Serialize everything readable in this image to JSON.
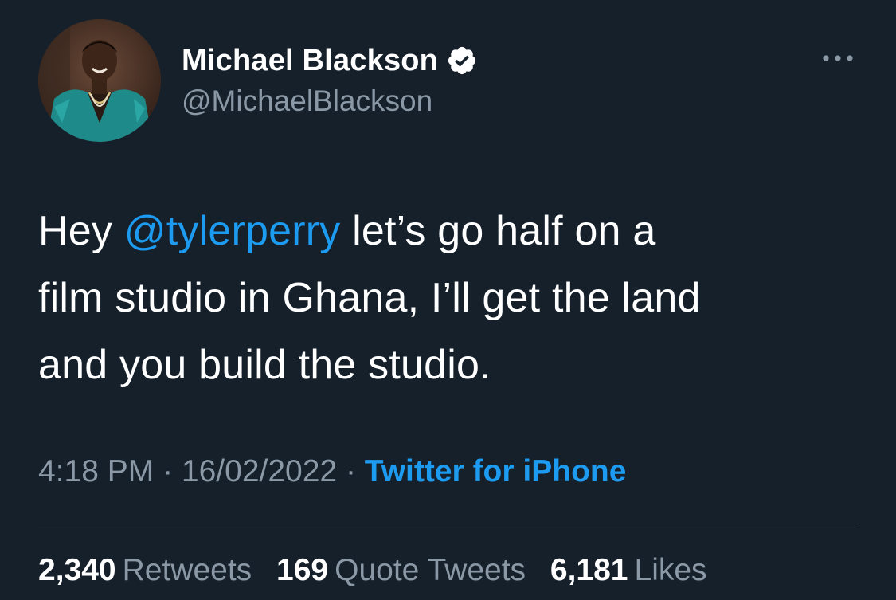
{
  "user": {
    "display_name": "Michael Blackson",
    "handle": "@MichaelBlackson",
    "verified": true
  },
  "tweet": {
    "text_before": "Hey ",
    "mention": "@tylerperry",
    "line1_after": " let’s go half on a",
    "line2": "film studio in Ghana, I’ll get the land",
    "line3": "and you build the studio."
  },
  "meta": {
    "time": "4:18 PM",
    "separator1": " · ",
    "date": "16/02/2022",
    "separator2": " · ",
    "source": "Twitter for iPhone"
  },
  "stats": {
    "retweets_count": "2,340",
    "retweets_label": "Retweets",
    "quotes_count": "169",
    "quotes_label": "Quote Tweets",
    "likes_count": "6,181",
    "likes_label": "Likes"
  },
  "icons": {
    "verified": "verified-badge-icon",
    "more": "more-horizontal-icon"
  },
  "colors": {
    "background": "#15202b",
    "accent": "#1d9bf0",
    "secondary_text": "#8b98a5",
    "divider": "#38444d"
  }
}
